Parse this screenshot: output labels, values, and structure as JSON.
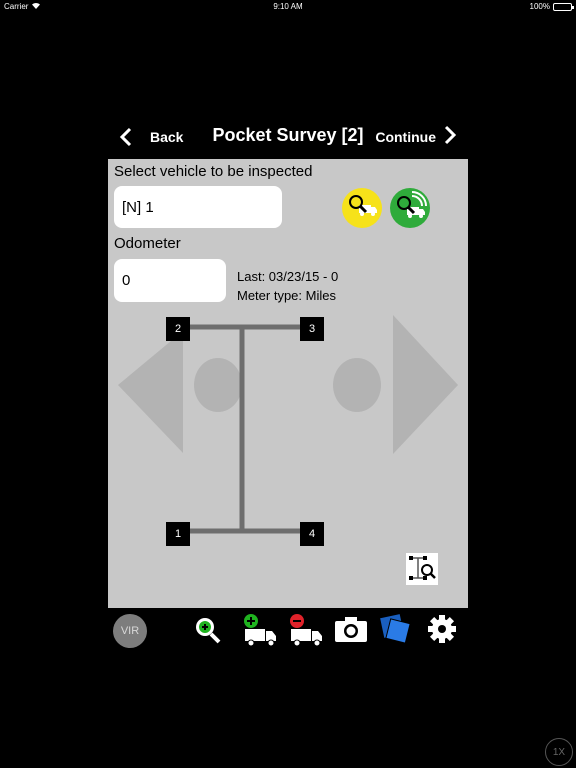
{
  "status_bar": {
    "carrier": "Carrier",
    "time": "9:10 AM",
    "battery": "100%"
  },
  "nav": {
    "back_label": "Back",
    "title": "Pocket Survey [2]",
    "continue_label": "Continue"
  },
  "vehicle": {
    "label": "Select vehicle to be inspected",
    "value": "[N] 1"
  },
  "odometer": {
    "label": "Odometer",
    "value": "0",
    "last": "Last: 03/23/15 - 0",
    "meter_type": "Meter type: Miles"
  },
  "axle_diagram": {
    "tires": [
      "2",
      "3",
      "1",
      "4"
    ]
  },
  "toolbar": {
    "vir_label": "VIR"
  },
  "speed_indicator": "1X",
  "colors": {
    "panel": "#c8c8c8",
    "yellow_button": "#f6e21a",
    "green_button": "#2fab3b",
    "vir_button": "#7d7d7d",
    "add_green": "#1fb31f",
    "remove_red": "#e0222a",
    "docs_blue": "#1f6fd6"
  }
}
